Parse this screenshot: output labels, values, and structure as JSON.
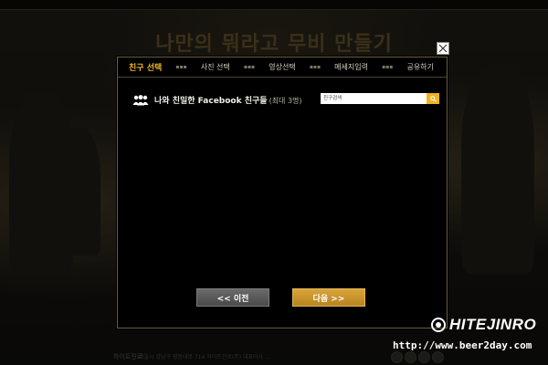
{
  "background": {
    "title": "나만의 뭐라고 무비 만들기",
    "footer_logo": "하이트진로",
    "footer_text": "서울시 강남구 영동대로 714 하이트진로(주) 대표이사 ..."
  },
  "modal": {
    "steps": [
      {
        "label": "친구 선택",
        "active": true
      },
      {
        "label": "사진 선택",
        "active": false
      },
      {
        "label": "영상선택",
        "active": false
      },
      {
        "label": "메세지입력",
        "active": false
      },
      {
        "label": "공유하기",
        "active": false
      }
    ],
    "step_separator": "▪▪▪",
    "friends": {
      "title": "나와 친밀한 Facebook 친구들",
      "limit": "(최대 3명)"
    },
    "search": {
      "placeholder": "친구검색"
    },
    "buttons": {
      "prev": "<< 이전",
      "next": "다음 >>"
    }
  },
  "watermark": {
    "brand": "HITEJINRO",
    "url": "http://www.beer2day.com"
  },
  "colors": {
    "accent": "#f0b422",
    "modal_bg": "#000000",
    "modal_border": "#6b5d3a"
  }
}
